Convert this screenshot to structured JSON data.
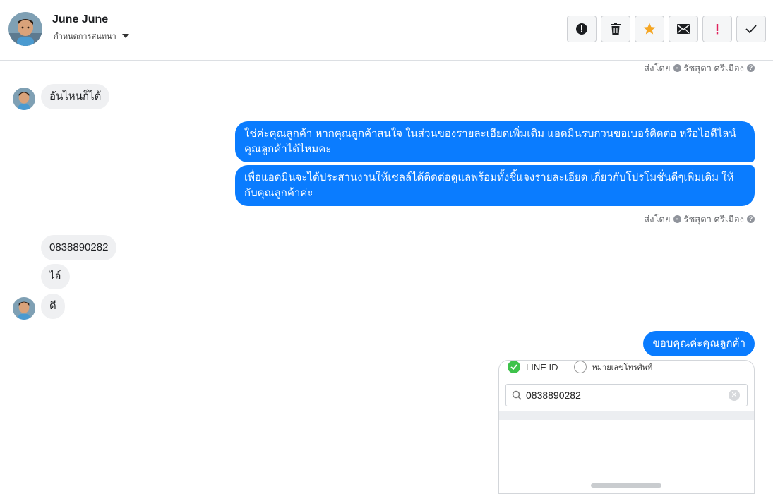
{
  "header": {
    "contact_name": "June June",
    "conversation_setting": "กำหนดการสนทนา",
    "actions": [
      {
        "name": "report-spam",
        "icon": "alert-circle-icon"
      },
      {
        "name": "delete",
        "icon": "trash-icon"
      },
      {
        "name": "star",
        "icon": "star-icon"
      },
      {
        "name": "mark-unread",
        "icon": "envelope-icon"
      },
      {
        "name": "important",
        "icon": "exclamation-icon"
      },
      {
        "name": "mark-done",
        "icon": "check-icon"
      }
    ]
  },
  "sent_by": {
    "label": "ส่งโดย",
    "agent": "รัชสุดา ศรีเมือง",
    "help": "?"
  },
  "messages": {
    "in_1": "อันไหนก็ได้",
    "out_1a": "ใช่ค่ะคุณลูกค้า หากคุณลูกค้าสนใจ ในส่วนของรายละเอียดเพิ่มเติม แอดมินรบกวนขอเบอร์ติดต่อ หรือไอดีไลน์ คุณลูกค้าได้ไหมคะ",
    "out_1b": "เพื่อแอดมินจะได้ประสานงานให้เซลล์ได้ติดต่อดูแลพร้อมทั้งชี้แจงรายละเอียด เกี่ยวกับโปรโมชั่นดีๆเพิ่มเติม ให้กับคุณลูกค้าค่ะ",
    "in_2": "0838890282",
    "in_3": "ไอ์",
    "in_4": "ดี",
    "out_2": "ขอบคุณค่ะคุณลูกค้า"
  },
  "attachment": {
    "option_line": "LINE ID",
    "option_phone": "หมายเลขโทรศัพท์",
    "search_value": "0838890282"
  },
  "colors": {
    "outgoing_bubble": "#0a7cff",
    "incoming_bubble": "#eff0f2",
    "star": "#f5a623",
    "important": "#e0245e"
  }
}
